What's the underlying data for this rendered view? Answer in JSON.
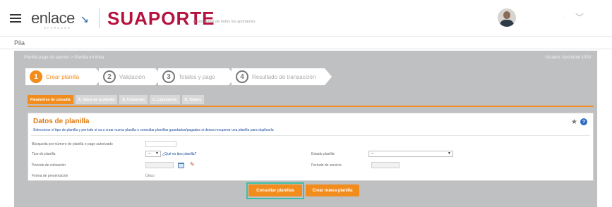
{
  "header": {
    "brand_enlace": "enlace",
    "brand_enlace_sub": "OPERADOR",
    "brand_suaporte": "SUAPORTE",
    "tagline": "aliado digital de todos los aportantes",
    "user_name": "·",
    "menu_icon": "hamburger-icon",
    "user_menu_icon": "chevron-down-icon"
  },
  "subheader": {
    "title": "Pila"
  },
  "breadcrumb": {
    "left": "Planilla pago de aportes  >  Planilla en línea",
    "right": "Usuario: Aportante  1000"
  },
  "steps": [
    {
      "number": "1",
      "label": "Crear planilla",
      "active": true
    },
    {
      "number": "2",
      "label": "Validación",
      "active": false
    },
    {
      "number": "3",
      "label": "Totales y pago",
      "active": false
    },
    {
      "number": "4",
      "label": "Resultado de transacción",
      "active": false
    }
  ],
  "subtabs": [
    "Parámetros de consulta",
    "A. Datos de la planilla",
    "B. Cotizantes",
    "C. Liquidación",
    "D. Totales"
  ],
  "form": {
    "title": "Datos de planilla",
    "description": "Seleccione el tipo de planilla y período si va a crear nueva planilla o consultar planillas guardadas/pagadas si desea recuperar una planilla para duplicarla",
    "fields": {
      "search_label": "Búsqueda por número de planilla o pago autorizado",
      "tipo_label": "Tipo de planilla",
      "tipo_value": "---",
      "tipo_link": "¿Qué es tipo planilla?",
      "periodo_cot_label": "Período de cotización",
      "forma_label": "Forma de presentación",
      "forma_value": "Único",
      "estado_label": "Estado planilla",
      "estado_value": "---",
      "periodo_serv_label": "Período de servicio"
    }
  },
  "buttons": {
    "consultar": "Consultar planillas",
    "crear": "Crear nueva planilla"
  },
  "colors": {
    "accent": "#f28c1c",
    "brand_red": "#b5123e",
    "link_blue": "#1a4a9e",
    "highlight": "#3fbfa3"
  }
}
